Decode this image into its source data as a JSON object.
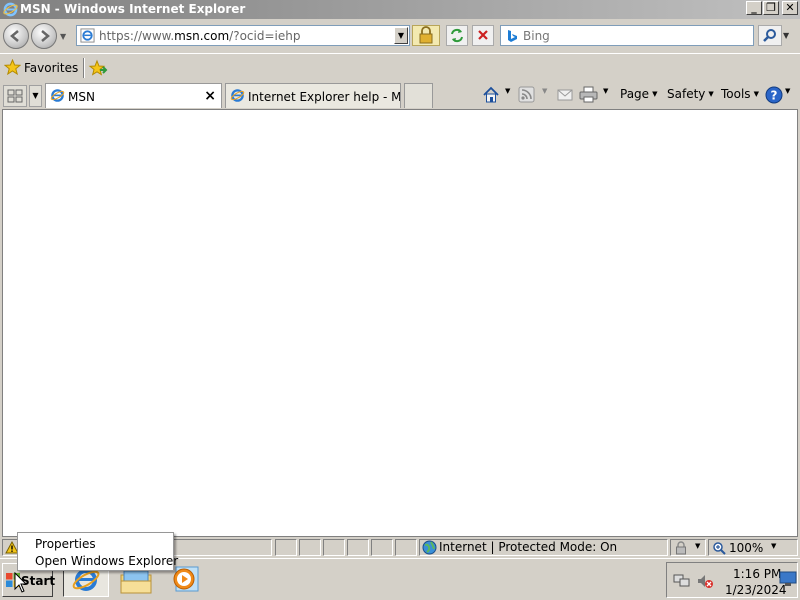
{
  "window": {
    "title": "MSN - Windows Internet Explorer",
    "caption_buttons": [
      "minimize",
      "restore",
      "close"
    ]
  },
  "address_bar": {
    "url_prefix": "https://www.",
    "url_domain": "msn.com",
    "url_rest": "/?ocid=iehp",
    "page_icon": "ie-page-icon",
    "security_icon": "lock-icon"
  },
  "search": {
    "placeholder": "Bing",
    "provider_icon": "bing-icon"
  },
  "favorites_bar": {
    "favorites_label": "Favorites"
  },
  "tabs": [
    {
      "label": "MSN",
      "active": true
    },
    {
      "label": "Internet Explorer help - Micr...",
      "active": false
    }
  ],
  "command_bar": {
    "page_label": "Page",
    "safety_label": "Safety",
    "tools_label": "Tools"
  },
  "status_bar": {
    "zone_text": "Internet | Protected Mode: On",
    "zoom": "100%"
  },
  "context_menu": {
    "items": [
      "Properties",
      "Open Windows Explorer"
    ]
  },
  "taskbar": {
    "start_label": "Start",
    "time": "1:16 PM",
    "date": "1/23/2024"
  },
  "colors": {
    "chrome": "#d4d0c8",
    "content": "#ffffff",
    "title_gradient_start": "#808080",
    "link_blue": "#1c5fb6"
  }
}
